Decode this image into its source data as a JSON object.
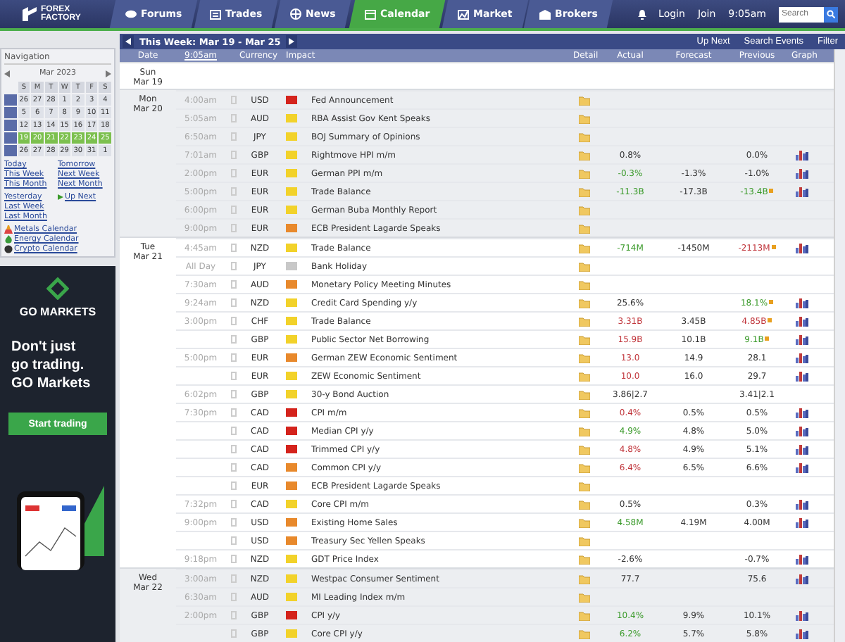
{
  "site": {
    "logo": [
      "FOREX",
      "FACTORY"
    ],
    "tabs": [
      {
        "label": "Forums",
        "selected": false
      },
      {
        "label": "Trades",
        "selected": false
      },
      {
        "label": "News",
        "selected": false
      },
      {
        "label": "Calendar",
        "selected": true
      },
      {
        "label": "Market",
        "selected": false
      },
      {
        "label": "Brokers",
        "selected": false
      }
    ],
    "login": "Login",
    "join": "Join",
    "time": "9:05am",
    "search": {
      "placeholder": "Search"
    }
  },
  "navigation": {
    "title": "Navigation",
    "month": "Mar 2023",
    "weekdays": [
      "S",
      "M",
      "T",
      "W",
      "T",
      "F",
      "S"
    ],
    "weeks": [
      {
        "current": false,
        "days": [
          "26",
          "27",
          "28",
          "1",
          "2",
          "3",
          "4"
        ]
      },
      {
        "current": false,
        "days": [
          "5",
          "6",
          "7",
          "8",
          "9",
          "10",
          "11"
        ]
      },
      {
        "current": false,
        "days": [
          "12",
          "13",
          "14",
          "15",
          "16",
          "17",
          "18"
        ]
      },
      {
        "current": true,
        "days": [
          "19",
          "20",
          "21",
          "22",
          "23",
          "24",
          "25"
        ]
      },
      {
        "current": false,
        "days": [
          "26",
          "27",
          "28",
          "29",
          "30",
          "31",
          "1"
        ]
      }
    ],
    "links": [
      [
        "Today",
        "Tomorrow"
      ],
      [
        "This Week",
        "Next Week"
      ],
      [
        "This Month",
        "Next Month"
      ]
    ],
    "links2": [
      "Yesterday",
      "Last Week",
      "Last Month"
    ],
    "up_next": "Up Next",
    "calendars": [
      "Metals Calendar",
      "Energy Calendar",
      "Crypto Calendar"
    ]
  },
  "ad": {
    "brand": "GO MARKETS",
    "headline": [
      "Don't just",
      "go trading.",
      "GO Markets"
    ],
    "button": "Start trading"
  },
  "calendar": {
    "period": "This Week: Mar 19 - Mar 25",
    "actions": [
      "Up Next",
      "Search Events",
      "Filter"
    ],
    "columns": [
      "Date",
      "9:05am",
      "Currency",
      "Impact",
      "Detail",
      "Actual",
      "Forecast",
      "Previous",
      "Graph"
    ],
    "days": [
      {
        "day": "Sun",
        "date": "Mar 19",
        "shaded": false
      },
      {
        "day": "Mon",
        "date": "Mar 20",
        "shaded": true,
        "events": [
          {
            "time": "4:00am",
            "currency": "USD",
            "color": "#d4231c",
            "title": "Fed Announcement",
            "graph": false
          },
          {
            "time": "5:05am",
            "currency": "AUD",
            "color": "#f2d22a",
            "title": "RBA Assist Gov Kent Speaks",
            "graph": false
          },
          {
            "time": "6:50am",
            "currency": "JPY",
            "color": "#f2d22a",
            "title": "BOJ Summary of Opinions",
            "graph": false
          },
          {
            "time": "7:01am",
            "currency": "GBP",
            "color": "#f2d22a",
            "title": "Rightmove HPI m/m",
            "actual": "0.8%",
            "previous": "0.0%",
            "graph": true
          },
          {
            "time": "2:00pm",
            "currency": "EUR",
            "color": "#f2d22a",
            "title": "German PPI m/m",
            "actual": {
              "text": "-0.3%",
              "color": "#3a9a2a"
            },
            "forecast": "-1.3%",
            "previous": "-1.0%",
            "graph": true
          },
          {
            "time": "5:00pm",
            "currency": "EUR",
            "color": "#f2d22a",
            "title": "Trade Balance",
            "actual": {
              "text": "-11.3B",
              "color": "#3a9a2a"
            },
            "forecast": "-17.3B",
            "previous": {
              "text": "-13.4B",
              "color": "#3a9a2a"
            },
            "graph": true
          },
          {
            "time": "6:00pm",
            "currency": "EUR",
            "color": "#f2d22a",
            "title": "German Buba Monthly Report",
            "graph": false
          },
          {
            "time": "9:00pm",
            "currency": "EUR",
            "color": "#e8892c",
            "title": "ECB President Lagarde Speaks",
            "graph": false
          }
        ]
      },
      {
        "day": "Tue",
        "date": "Mar 21",
        "shaded": false,
        "events": [
          {
            "time": "4:45am",
            "currency": "NZD",
            "color": "#f2d22a",
            "title": "Trade Balance",
            "actual": {
              "text": "-714M",
              "color": "#3a9a2a"
            },
            "forecast": "-1450M",
            "previous": {
              "text": "-2113M",
              "color": "#c0343a"
            },
            "graph": true
          },
          {
            "time": "All Day",
            "currency": "JPY",
            "color": "#c8c8c8",
            "title": "Bank Holiday",
            "graph": false
          },
          {
            "time": "7:30am",
            "currency": "AUD",
            "color": "#e8892c",
            "title": "Monetary Policy Meeting Minutes",
            "graph": false
          },
          {
            "time": "9:24am",
            "currency": "NZD",
            "color": "#f2d22a",
            "title": "Credit Card Spending y/y",
            "actual": "25.6%",
            "previous": {
              "text": "18.1%",
              "color": "#3a9a2a"
            },
            "graph": true
          },
          {
            "time": "3:00pm",
            "currency": "CHF",
            "color": "#f2d22a",
            "title": "Trade Balance",
            "actual": {
              "text": "3.31B",
              "color": "#c0343a"
            },
            "forecast": "3.45B",
            "previous": {
              "text": "4.85B",
              "color": "#c0343a"
            },
            "graph": true
          },
          {
            "currency": "GBP",
            "color": "#f2d22a",
            "title": "Public Sector Net Borrowing",
            "actual": {
              "text": "15.9B",
              "color": "#c0343a"
            },
            "forecast": "10.1B",
            "previous": {
              "text": "9.1B",
              "color": "#3a9a2a"
            },
            "graph": true
          },
          {
            "time": "5:00pm",
            "currency": "EUR",
            "color": "#e8892c",
            "title": "German ZEW Economic Sentiment",
            "actual": {
              "text": "13.0",
              "color": "#c0343a"
            },
            "forecast": "14.9",
            "previous": "28.1",
            "graph": true
          },
          {
            "currency": "EUR",
            "color": "#f2d22a",
            "title": "ZEW Economic Sentiment",
            "actual": {
              "text": "10.0",
              "color": "#c0343a"
            },
            "forecast": "16.0",
            "previous": "29.7",
            "graph": true
          },
          {
            "time": "6:02pm",
            "currency": "GBP",
            "color": "#f2d22a",
            "title": "30-y Bond Auction",
            "actual": "3.86|2.7",
            "previous": "3.41|2.1",
            "graph": false
          },
          {
            "time": "7:30pm",
            "currency": "CAD",
            "color": "#d4231c",
            "title": "CPI m/m",
            "actual": {
              "text": "0.4%",
              "color": "#c0343a"
            },
            "forecast": "0.5%",
            "previous": "0.5%",
            "graph": true
          },
          {
            "currency": "CAD",
            "color": "#d4231c",
            "title": "Median CPI y/y",
            "actual": {
              "text": "4.9%",
              "color": "#3a9a2a"
            },
            "forecast": "4.8%",
            "previous": "5.0%",
            "graph": true
          },
          {
            "currency": "CAD",
            "color": "#d4231c",
            "title": "Trimmed CPI y/y",
            "actual": {
              "text": "4.8%",
              "color": "#c0343a"
            },
            "forecast": "4.9%",
            "previous": "5.1%",
            "graph": true
          },
          {
            "currency": "CAD",
            "color": "#e8892c",
            "title": "Common CPI y/y",
            "actual": {
              "text": "6.4%",
              "color": "#c0343a"
            },
            "forecast": "6.5%",
            "previous": "6.6%",
            "graph": true
          },
          {
            "currency": "EUR",
            "color": "#e8892c",
            "title": "ECB President Lagarde Speaks",
            "graph": false
          },
          {
            "time": "7:32pm",
            "currency": "CAD",
            "color": "#f2d22a",
            "title": "Core CPI m/m",
            "actual": "0.5%",
            "previous": "0.3%",
            "graph": true
          },
          {
            "time": "9:00pm",
            "currency": "USD",
            "color": "#e8892c",
            "title": "Existing Home Sales",
            "actual": {
              "text": "4.58M",
              "color": "#3a9a2a"
            },
            "forecast": "4.19M",
            "previous": "4.00M",
            "graph": true
          },
          {
            "currency": "USD",
            "color": "#e8892c",
            "title": "Treasury Sec Yellen Speaks",
            "graph": false
          },
          {
            "time": "9:18pm",
            "currency": "NZD",
            "color": "#f2d22a",
            "title": "GDT Price Index",
            "actual": "-2.6%",
            "previous": "-0.7%",
            "graph": true
          }
        ]
      },
      {
        "day": "Wed",
        "date": "Mar 22",
        "shaded": true,
        "events": [
          {
            "time": "3:00am",
            "currency": "NZD",
            "color": "#f2d22a",
            "title": "Westpac Consumer Sentiment",
            "actual": "77.7",
            "previous": "75.6",
            "graph": true
          },
          {
            "time": "6:30am",
            "currency": "AUD",
            "color": "#f2d22a",
            "title": "MI Leading Index m/m",
            "graph": false
          },
          {
            "time": "2:00pm",
            "currency": "GBP",
            "color": "#d4231c",
            "title": "CPI y/y",
            "actual": {
              "text": "10.4%",
              "color": "#3a9a2a"
            },
            "forecast": "9.9%",
            "previous": "10.1%",
            "graph": true
          },
          {
            "currency": "GBP",
            "color": "#f2d22a",
            "title": "Core CPI y/y",
            "actual": {
              "text": "6.2%",
              "color": "#3a9a2a"
            },
            "forecast": "5.7%",
            "previous": "5.8%",
            "graph": true
          }
        ]
      }
    ]
  }
}
